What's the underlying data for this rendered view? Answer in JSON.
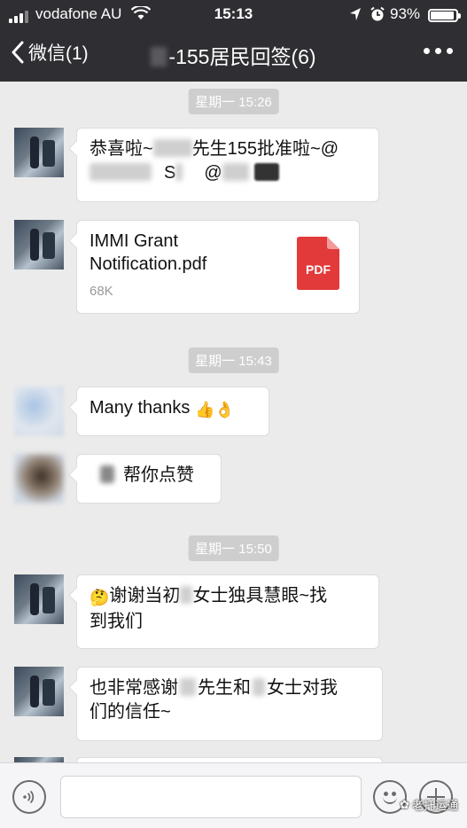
{
  "status_bar": {
    "carrier": "vodafone AU",
    "time": "15:13",
    "battery_percent": "93%",
    "battery_level": 0.93,
    "icons": [
      "signal-icon",
      "wifi-icon",
      "location-icon",
      "alarm-icon",
      "battery-icon"
    ]
  },
  "nav": {
    "back_label": "微信(1)",
    "title": "-155居民回签(6)",
    "more_icon": "more-dots-icon"
  },
  "messages": [
    {
      "time": "星期一 15:26"
    },
    {
      "text_parts": [
        "恭喜啦~",
        "先生155批准啦~@",
        "S",
        "@"
      ]
    },
    {
      "file_name": "IMMI Grant Notification.pdf",
      "file_size": "68K",
      "file_icon_label": "PDF"
    },
    {
      "time": "星期一 15:43"
    },
    {
      "text": "Many thanks",
      "emojis": [
        "👍",
        "👌"
      ]
    },
    {
      "text": "帮你点赞"
    },
    {
      "time": "星期一 15:50"
    },
    {
      "emoji": "🤔",
      "text_parts": [
        "谢谢当初",
        "女士独具慧眼~找",
        "到我们"
      ]
    },
    {
      "text_parts": [
        "也非常感谢",
        "先生和",
        "女士对我",
        "们的信任~"
      ]
    }
  ],
  "input_bar": {
    "input_value": "",
    "icons": [
      "voice-icon",
      "emoji-icon",
      "plus-icon"
    ]
  },
  "watermark": {
    "text": "老托运通"
  }
}
